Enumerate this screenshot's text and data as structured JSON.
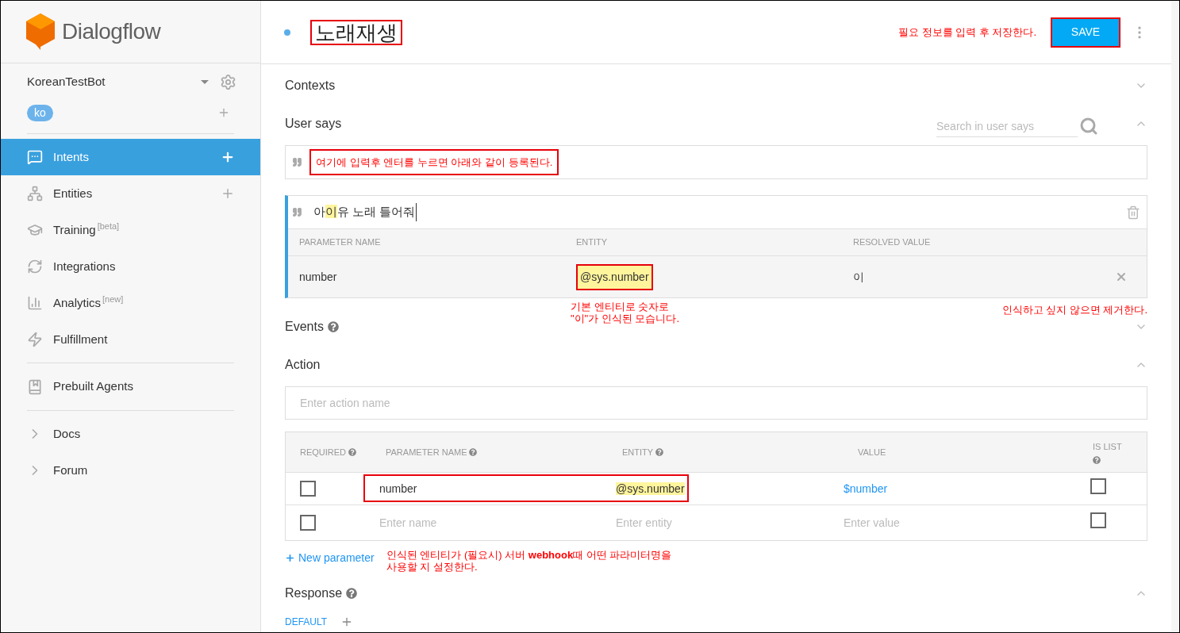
{
  "sidebar": {
    "logo": "Dialogflow",
    "agent": "KoreanTestBot",
    "language": "ko",
    "items": [
      {
        "kind": "item",
        "label": "Intents",
        "selected": true,
        "add": true
      },
      {
        "kind": "item",
        "label": "Entities",
        "selected": false,
        "add": true
      },
      {
        "kind": "item",
        "label": "Training",
        "tag": "[beta]",
        "selected": false,
        "add": false
      },
      {
        "kind": "item",
        "label": "Integrations",
        "selected": false,
        "add": false
      },
      {
        "kind": "item",
        "label": "Analytics",
        "tag": "[new]",
        "selected": false,
        "add": false
      },
      {
        "kind": "item",
        "label": "Fulfillment",
        "selected": false,
        "add": false
      },
      {
        "kind": "divider"
      },
      {
        "kind": "item",
        "label": "Prebuilt Agents",
        "selected": false,
        "add": false
      },
      {
        "kind": "divider"
      },
      {
        "kind": "link",
        "label": "Docs",
        "selected": false,
        "add": false
      },
      {
        "kind": "link",
        "label": "Forum",
        "selected": false,
        "add": false
      }
    ]
  },
  "header": {
    "title": "노래재생",
    "note": "필요 정보를 입력 후 저장한다.",
    "save": "SAVE"
  },
  "contexts": {
    "title": "Contexts",
    "expanded": false
  },
  "user_says": {
    "title": "User says",
    "expanded": true,
    "search_placeholder": "Search in user says",
    "input_value": "여기에 입력후 엔터를 누르면 아래와 같이 등록된다.",
    "phrase": {
      "segments": [
        {
          "text": "아",
          "highlight": false
        },
        {
          "text": "이",
          "highlight": true
        },
        {
          "text": "유 노래 틀어줘",
          "highlight": false
        }
      ],
      "columns": [
        "PARAMETER NAME",
        "ENTITY",
        "RESOLVED VALUE"
      ],
      "rows": [
        {
          "parameter": "number",
          "entity": "@sys.number",
          "resolved": "이"
        }
      ]
    },
    "notes": [
      "기본 엔티티로 숫자로\n\"이\"가 인식된 모습니다.",
      "인식하고 싶지 않으면  제거한다."
    ]
  },
  "events": {
    "title": "Events",
    "expanded": false
  },
  "action": {
    "title": "Action",
    "expanded": true,
    "placeholder": "Enter action name",
    "columns": [
      {
        "label": "REQUIRED",
        "help": true
      },
      {
        "label": "PARAMETER NAME",
        "help": true
      },
      {
        "label": "ENTITY",
        "help": true
      },
      {
        "label": "VALUE",
        "help": false
      },
      {
        "label": "IS LIST",
        "help": true
      }
    ],
    "rows": [
      {
        "kind": "filled",
        "required": false,
        "name": "number",
        "entity": "@sys.number",
        "value": "$number",
        "is_list": false
      },
      {
        "kind": "new",
        "required": false,
        "name": "Enter name",
        "entity": "Enter entity",
        "value": "Enter value",
        "is_list": false
      }
    ],
    "new_parameter": "New parameter",
    "note": "인식된 엔티티가 (필요시) 서버 **webhook**때 어떤 파라미터명을\n사용할 지 설정한다."
  },
  "response": {
    "title": "Response",
    "expanded": true,
    "tabs": [
      {
        "label": "DEFAULT",
        "selected": true
      }
    ]
  }
}
